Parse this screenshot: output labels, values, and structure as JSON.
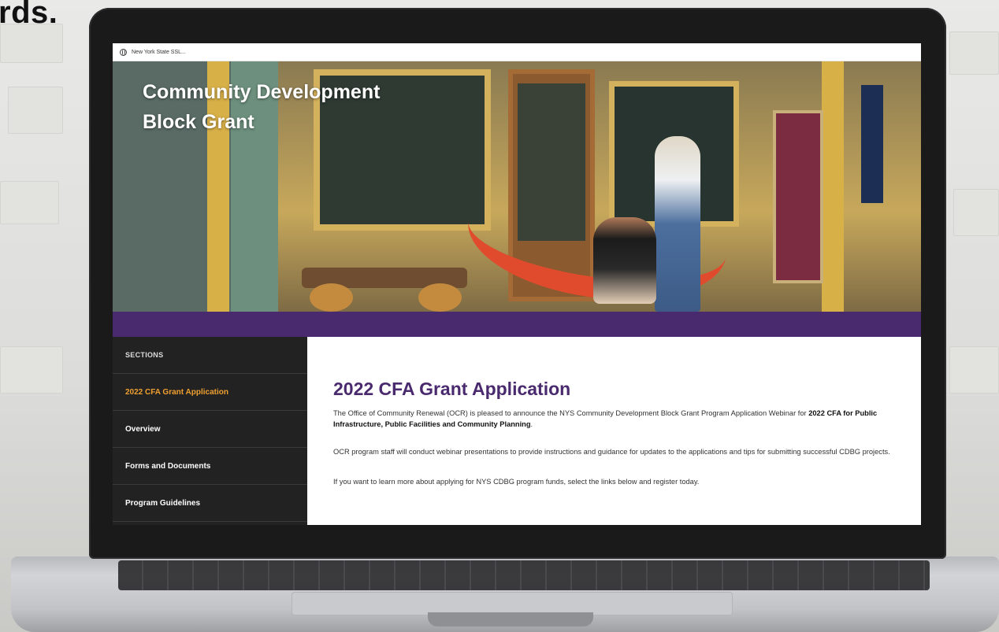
{
  "overlay": {
    "corner_text": "rds."
  },
  "browser": {
    "tab_title": "New York State SSL..."
  },
  "hero": {
    "title_line1": "Community Development",
    "title_line2": "Block Grant"
  },
  "sidebar": {
    "heading": "SECTIONS",
    "items": [
      {
        "label": "2022 CFA Grant Application",
        "active": true
      },
      {
        "label": "Overview",
        "active": false
      },
      {
        "label": "Forms and Documents",
        "active": false
      },
      {
        "label": "Program Guidelines",
        "active": false
      }
    ]
  },
  "main": {
    "title": "2022 CFA Grant Application",
    "p1_text": "The Office of Community Renewal (OCR) is pleased to announce the NYS Community Development Block Grant Program Application Webinar for ",
    "p1_bold": "2022 CFA for Public Infrastructure, Public Facilities and Community Planning",
    "p1_end": ".",
    "p2": "OCR program staff will conduct webinar presentations to provide instructions and guidance for updates to the applications and tips for submitting successful CDBG projects.",
    "p3": "If you want to learn more about applying for NYS CDBG program funds, select the links below and register today."
  },
  "colors": {
    "purple": "#4a2a6e",
    "active_orange": "#f0a030",
    "sidebar_bg": "#222222"
  }
}
